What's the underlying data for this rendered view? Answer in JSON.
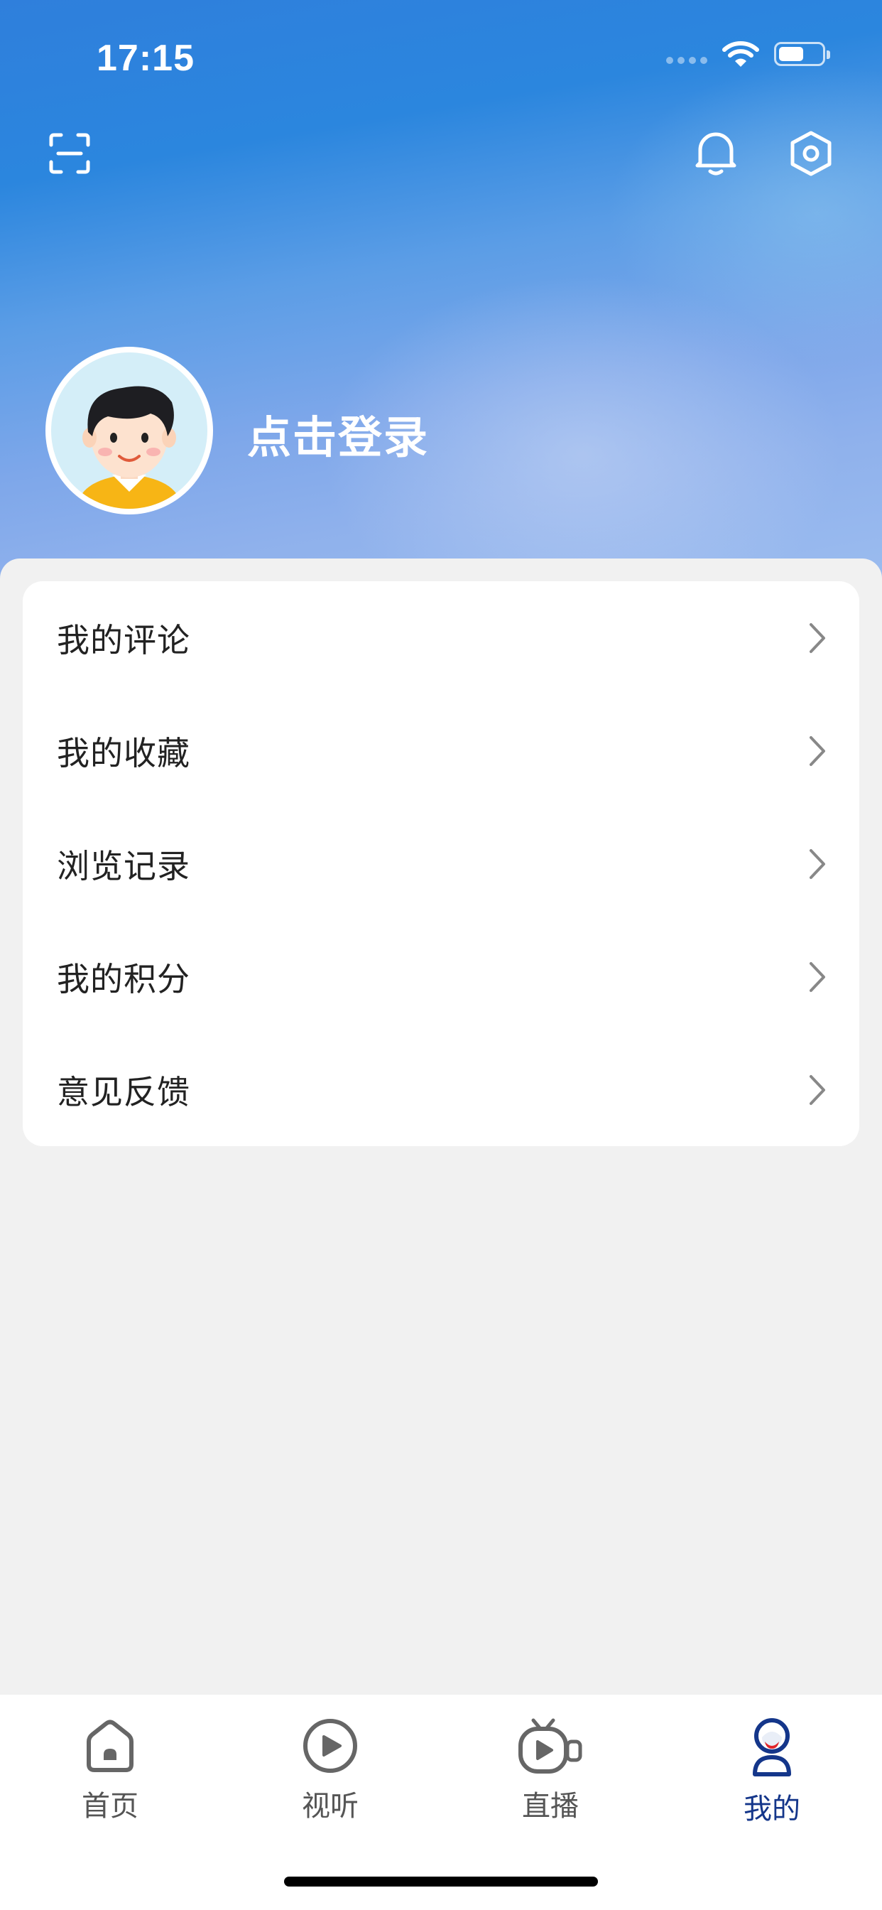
{
  "status_bar": {
    "time": "17:15"
  },
  "header": {
    "scan_icon": "scan-icon",
    "bell_icon": "bell-icon",
    "settings_icon": "settings-hexagon-icon"
  },
  "profile": {
    "login_text": "点击登录"
  },
  "menu": {
    "items": [
      {
        "label": "我的评论"
      },
      {
        "label": "我的收藏"
      },
      {
        "label": "浏览记录"
      },
      {
        "label": "我的积分"
      },
      {
        "label": "意见反馈"
      }
    ]
  },
  "tabs": [
    {
      "label": "首页",
      "icon": "home-icon"
    },
    {
      "label": "视听",
      "icon": "play-circle-icon"
    },
    {
      "label": "直播",
      "icon": "live-tv-icon"
    },
    {
      "label": "我的",
      "icon": "profile-icon",
      "active": true
    }
  ],
  "colors": {
    "accent": "#14368a",
    "header_blue": "#2b86de",
    "background": "#f1f1f1"
  }
}
